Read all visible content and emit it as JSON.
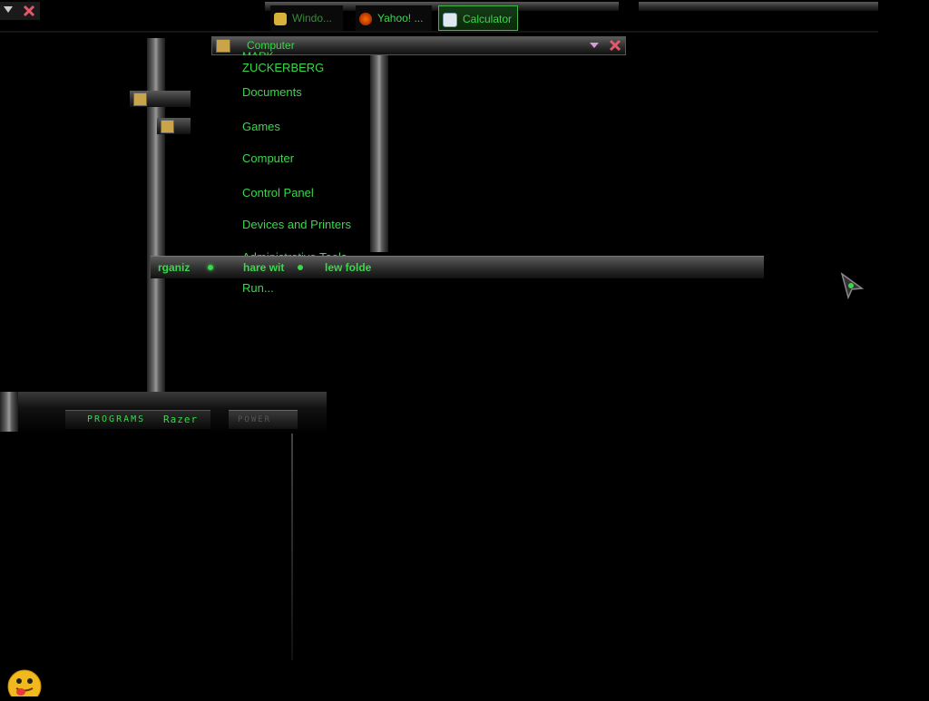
{
  "topbar": {
    "left_dropdown_icon": "triangle-down-icon",
    "left_close_icon": "close-x-icon"
  },
  "taskbar": {
    "items": [
      {
        "label": "Windo...",
        "icon": "folder-icon"
      },
      {
        "label": "Yahoo! ...",
        "icon": "yahoo-icon"
      },
      {
        "label": "Calculator",
        "icon": "calculator-icon"
      }
    ]
  },
  "computer_window": {
    "title": "Computer"
  },
  "start_menu": {
    "user_name_line1": "MARK",
    "user_name_line2": "ZUCKERBERG",
    "items": [
      "Documents",
      "Games",
      "Computer",
      "Control Panel",
      "Devices and Printers",
      "Administrative Tools",
      "Run..."
    ]
  },
  "explorer_toolbar": {
    "organize": "rganiz",
    "share": "hare wit",
    "new_folder": "lew folde"
  },
  "start_bar": {
    "programs_label": "PROGRAMS",
    "brand_label": "Razer",
    "power_label": "POWER"
  },
  "colors": {
    "accent_green": "#39d84a",
    "background": "#000000"
  }
}
